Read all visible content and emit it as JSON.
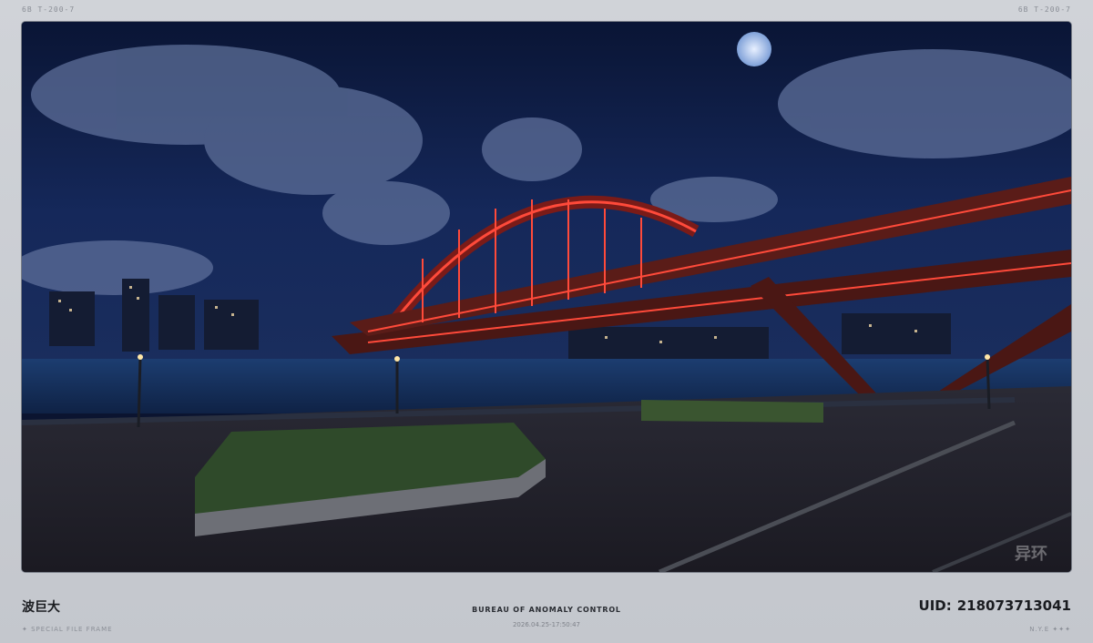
{
  "frame": {
    "top_left_label": "6B  T-200-7",
    "top_right_label": "6B  T-200-7",
    "watermark": "异环",
    "name": "波巨大",
    "subtitle_left": "✦ SPECIAL FILE FRAME",
    "center_title": "BUREAU OF ANOMALY CONTROL",
    "center_date": "2026.04.25-17:50:47",
    "uid_label": "UID:",
    "uid_value": "218073713041",
    "subtitle_right": "N.Y.E ✦✦✦"
  },
  "colors": {
    "sky": "#0b1430",
    "bridge_light": "#ff4a3a",
    "frame_bg": "#c9ccd2"
  }
}
